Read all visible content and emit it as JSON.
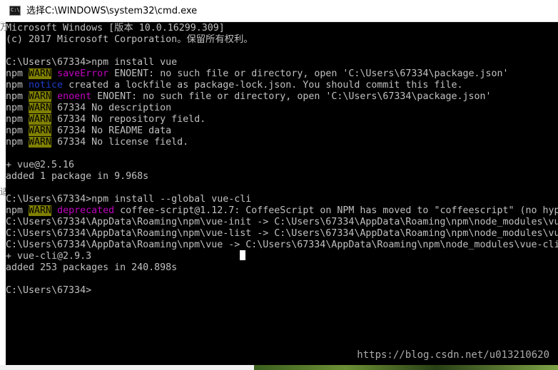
{
  "window": {
    "title": "选择C:\\WINDOWS\\system32\\cmd.exe",
    "icon_text": "C:\\"
  },
  "left_edge": {
    "glyph1": "万",
    "glyph2": "适"
  },
  "console": {
    "lines": [
      [
        {
          "t": "Microsoft Windows [版本 10.0.16299.309]"
        }
      ],
      [
        {
          "t": "(c) 2017 Microsoft Corporation。保留所有权利。"
        }
      ],
      [
        {
          "t": ""
        }
      ],
      [
        {
          "t": "C:\\Users\\67334>npm install vue"
        }
      ],
      [
        {
          "t": "npm "
        },
        {
          "t": "WARN",
          "c": "warn"
        },
        {
          "t": " "
        },
        {
          "t": "saveError",
          "c": "mag"
        },
        {
          "t": " ENOENT: no such file or directory, open 'C:\\Users\\67334\\package.json'"
        }
      ],
      [
        {
          "t": "npm "
        },
        {
          "t": "notice",
          "c": "blue"
        },
        {
          "t": " created a lockfile as package-lock.json. You should commit this file."
        }
      ],
      [
        {
          "t": "npm "
        },
        {
          "t": "WARN",
          "c": "warn"
        },
        {
          "t": " "
        },
        {
          "t": "enoent",
          "c": "mag"
        },
        {
          "t": " ENOENT: no such file or directory, open 'C:\\Users\\67334\\package.json'"
        }
      ],
      [
        {
          "t": "npm "
        },
        {
          "t": "WARN",
          "c": "warn"
        },
        {
          "t": " 67334 No description"
        }
      ],
      [
        {
          "t": "npm "
        },
        {
          "t": "WARN",
          "c": "warn"
        },
        {
          "t": " 67334 No repository field."
        }
      ],
      [
        {
          "t": "npm "
        },
        {
          "t": "WARN",
          "c": "warn"
        },
        {
          "t": " 67334 No README data"
        }
      ],
      [
        {
          "t": "npm "
        },
        {
          "t": "WARN",
          "c": "warn"
        },
        {
          "t": " 67334 No license field."
        }
      ],
      [
        {
          "t": ""
        }
      ],
      [
        {
          "t": "+ vue@2.5.16"
        }
      ],
      [
        {
          "t": "added 1 package in 9.968s"
        }
      ],
      [
        {
          "t": ""
        }
      ],
      [
        {
          "t": "C:\\Users\\67334>npm install --global vue-cli"
        }
      ],
      [
        {
          "t": "npm "
        },
        {
          "t": "WARN",
          "c": "warn"
        },
        {
          "t": " "
        },
        {
          "t": "deprecated",
          "c": "mag"
        },
        {
          "t": " coffee-script@1.12.7: CoffeeScript on NPM has moved to \"coffeescript\" (no hyp"
        }
      ],
      [
        {
          "t": "C:\\Users\\67334\\AppData\\Roaming\\npm\\vue-init -> C:\\Users\\67334\\AppData\\Roaming\\npm\\node_modules\\vu"
        }
      ],
      [
        {
          "t": "C:\\Users\\67334\\AppData\\Roaming\\npm\\vue-list -> C:\\Users\\67334\\AppData\\Roaming\\npm\\node_modules\\vu"
        }
      ],
      [
        {
          "t": "C:\\Users\\67334\\AppData\\Roaming\\npm\\vue -> C:\\Users\\67334\\AppData\\Roaming\\npm\\node_modules\\vue-cli"
        }
      ],
      [
        {
          "t": "+ vue-cli@2.9.3"
        }
      ],
      [
        {
          "t": "added 253 packages in 240.898s"
        }
      ],
      [
        {
          "t": ""
        }
      ],
      [
        {
          "t": "C:\\Users\\67334>"
        }
      ]
    ]
  },
  "watermark": "https://blog.csdn.net/u013210620"
}
